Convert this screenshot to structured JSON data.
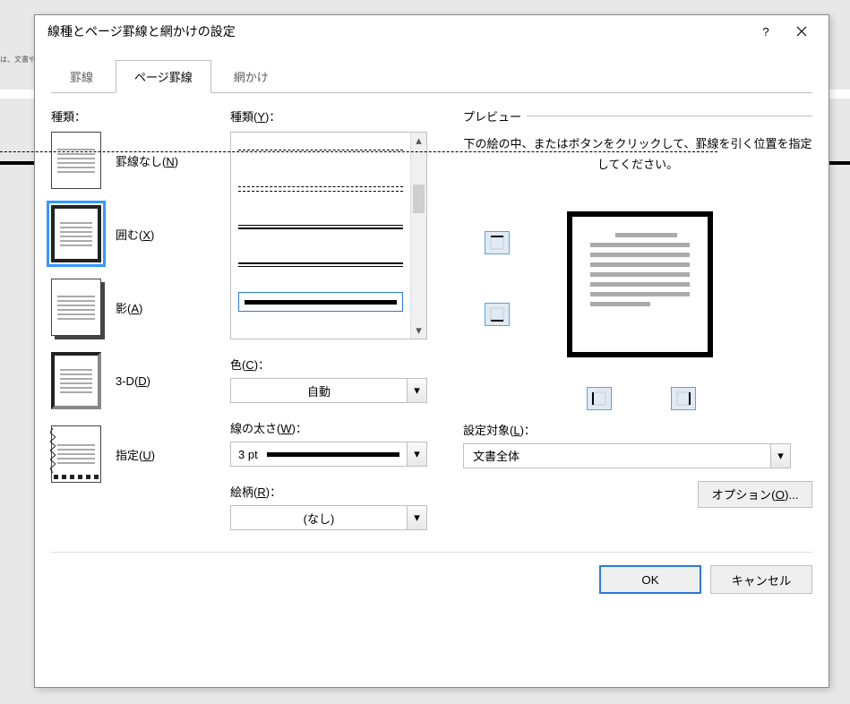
{
  "bg_hint": "は、文書や\nるためのア",
  "dialog": {
    "title": "線種とページ罫線と網かけの設定",
    "help": "?",
    "close": "×"
  },
  "tabs": [
    {
      "label": "罫線",
      "active": false
    },
    {
      "label": "ページ罫線",
      "active": true
    },
    {
      "label": "網かけ",
      "active": false
    }
  ],
  "kind": {
    "label": "種類：",
    "items": [
      {
        "label": "罫線なし(N)",
        "mn": "N",
        "selected": false
      },
      {
        "label": "囲む(X)",
        "mn": "X",
        "selected": true
      },
      {
        "label": "影(A)",
        "mn": "A",
        "selected": false
      },
      {
        "label": "3-D(D)",
        "mn": "D",
        "selected": false
      },
      {
        "label": "指定(U)",
        "mn": "U",
        "selected": false
      }
    ]
  },
  "style": {
    "label": "種類(Y)：",
    "mn": "Y"
  },
  "color": {
    "label": "色(C)：",
    "mn": "C",
    "value": "自動"
  },
  "width": {
    "label": "線の太さ(W)：",
    "mn": "W",
    "value": "3 pt"
  },
  "art": {
    "label": "絵柄(R)：",
    "mn": "R",
    "value": "(なし)"
  },
  "preview": {
    "label": "プレビュー",
    "hint": "下の絵の中、またはボタンをクリックして、罫線を引く位置を指定してください。"
  },
  "target": {
    "label": "設定対象(L)：",
    "mn": "L",
    "value": "文書全体"
  },
  "buttons": {
    "options": "オプション(O)...",
    "options_mn": "O",
    "ok": "OK",
    "cancel": "キャンセル"
  }
}
